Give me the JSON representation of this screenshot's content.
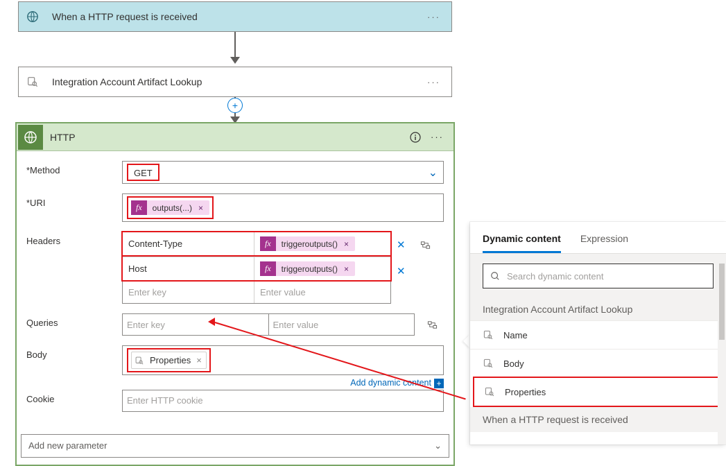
{
  "steps": {
    "trigger": {
      "title": "When a HTTP request is received"
    },
    "lookup": {
      "title": "Integration Account Artifact Lookup"
    }
  },
  "http": {
    "title": "HTTP",
    "labels": {
      "method": "*Method",
      "uri": "*URI",
      "headers": "Headers",
      "queries": "Queries",
      "body": "Body",
      "cookie": "Cookie",
      "add_param": "Add new parameter"
    },
    "method_value": "GET",
    "uri_token": "outputs(...)",
    "headers": [
      {
        "key": "Content-Type",
        "value_token": "triggeroutputs()"
      },
      {
        "key": "Host",
        "value_token": "triggeroutputs()"
      }
    ],
    "headers_placeholder_key": "Enter key",
    "headers_placeholder_value": "Enter value",
    "queries_placeholder_key": "Enter key",
    "queries_placeholder_value": "Enter value",
    "body_token": "Properties",
    "cookie_placeholder": "Enter HTTP cookie",
    "add_dynamic_label": "Add dynamic content"
  },
  "dyn": {
    "tabs": {
      "dynamic": "Dynamic content",
      "expression": "Expression"
    },
    "search_placeholder": "Search dynamic content",
    "section1": "Integration Account Artifact Lookup",
    "items1": [
      "Name",
      "Body",
      "Properties"
    ],
    "section2": "When a HTTP request is received"
  }
}
